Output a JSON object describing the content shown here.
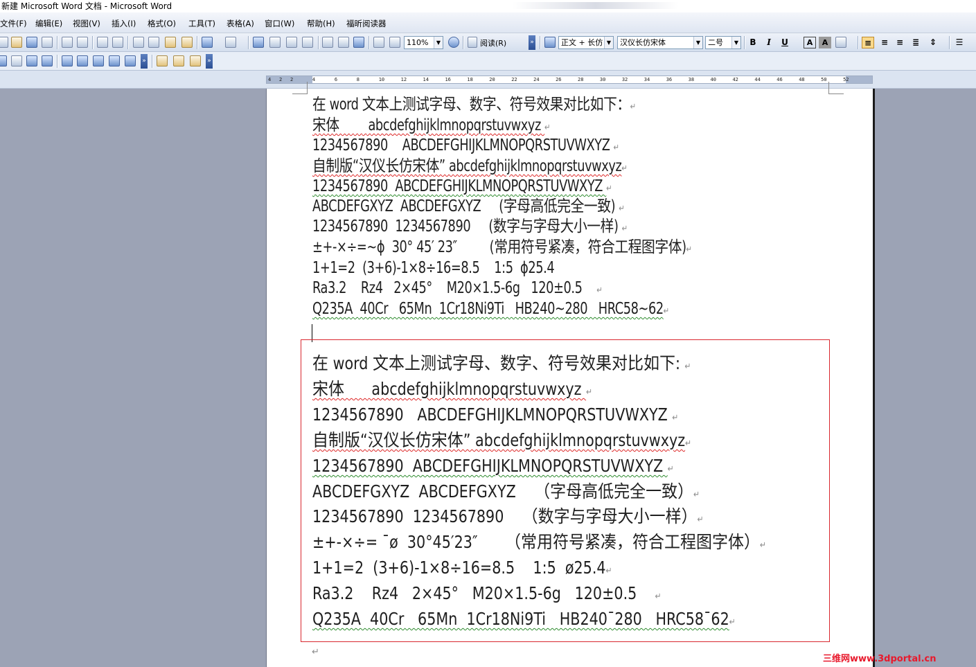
{
  "window": {
    "title": "新建 Microsoft Word 文档 - Microsoft Word"
  },
  "menu": {
    "items": [
      "文件(F)",
      "编辑(E)",
      "视图(V)",
      "插入(I)",
      "格式(O)",
      "工具(T)",
      "表格(A)",
      "窗口(W)",
      "帮助(H)",
      "福昕阅读器"
    ]
  },
  "toolbar": {
    "zoom": "110%",
    "read_label": "阅读(R)",
    "style": "正文 + 长仿",
    "font": "汉仪长仿宋体",
    "size": "二号",
    "bold": "B",
    "italic": "I",
    "underline": "U",
    "font_color": "A",
    "highlight": "A"
  },
  "ruler": {
    "ticks": [
      "4",
      "2",
      "2",
      "4",
      "6",
      "8",
      "10",
      "12",
      "14",
      "16",
      "18",
      "20",
      "22",
      "24",
      "26",
      "28",
      "30",
      "32",
      "34",
      "36",
      "38",
      "40",
      "42",
      "44",
      "46",
      "48",
      "50",
      "52"
    ]
  },
  "document": {
    "top_block": [
      "在 word 文本上测试字母、数字、符号效果对比如下：",
      "宋体        abcdefghijklmnopqrstuvwxyz ",
      "1234567890    ABCDEFGHIJKLMNOPQRSTUVWXYZ ",
      "自制版“汉仪长仿宋体” abcdefghijklmnopqrstuvwxyz",
      "1234567890  ABCDEFGHIJKLMNOPQRSTUVWXYZ ",
      "ABCDEFGXYZ  ABCDEFGXYZ     (字母高低完全一致) ",
      "1234567890  1234567890     (数字与字母大小一样) ",
      "±+-×÷=~ϕ  30° 45′ 23″         (常用符号紧凑，符合工程图字体)",
      "1+1=2  (3+6)-1×8÷16=8.5    1:5  ϕ25.4",
      "Ra3.2    Rz4   2×45°    M20×1.5-6g   120±0.5    ",
      "Q235A  40Cr   65Mn  1Cr18Ni9Ti   HB240~280   HRC58~62"
    ],
    "bottom_block": [
      "在 word 文本上测试字母、数字、符号效果对比如下: ",
      "宋体      abcdefghijklmnopqrstuvwxyz ",
      "1234567890   ABCDEFGHIJKLMNOPQRSTUVWXYZ ",
      "自制版“汉仪长仿宋体” abcdefghijklmnopqrstuvwxyz",
      "1234567890  ABCDEFGHIJKLMNOPQRSTUVWXYZ ",
      "ABCDEFGXYZ  ABCDEFGXYZ    （字母高低完全一致）",
      "1234567890  1234567890    （数字与字母大小一样）",
      "±+-×÷= ¯ø  30°45′23″      （常用符号紧凑，符合工程图字体）",
      "1+1=2  (3+6)-1×8÷16=8.5    1:5  ø25.4",
      "Ra3.2    Rz4   2×45°   M20×1.5-6g   120±0.5    ",
      "Q235A  40Cr   65Mn  1Cr18Ni9Ti   HB240¯280   HRC58¯62"
    ],
    "paragraph_mark": "↵"
  },
  "watermark": {
    "text": "三维网www.3dportal.cn"
  },
  "colors": {
    "workspace": "#9ca3b5",
    "highlight_box": "#d9272e",
    "spelling": "#d22222",
    "grammar": "#2a8a2a",
    "watermark": "#e8192c"
  }
}
